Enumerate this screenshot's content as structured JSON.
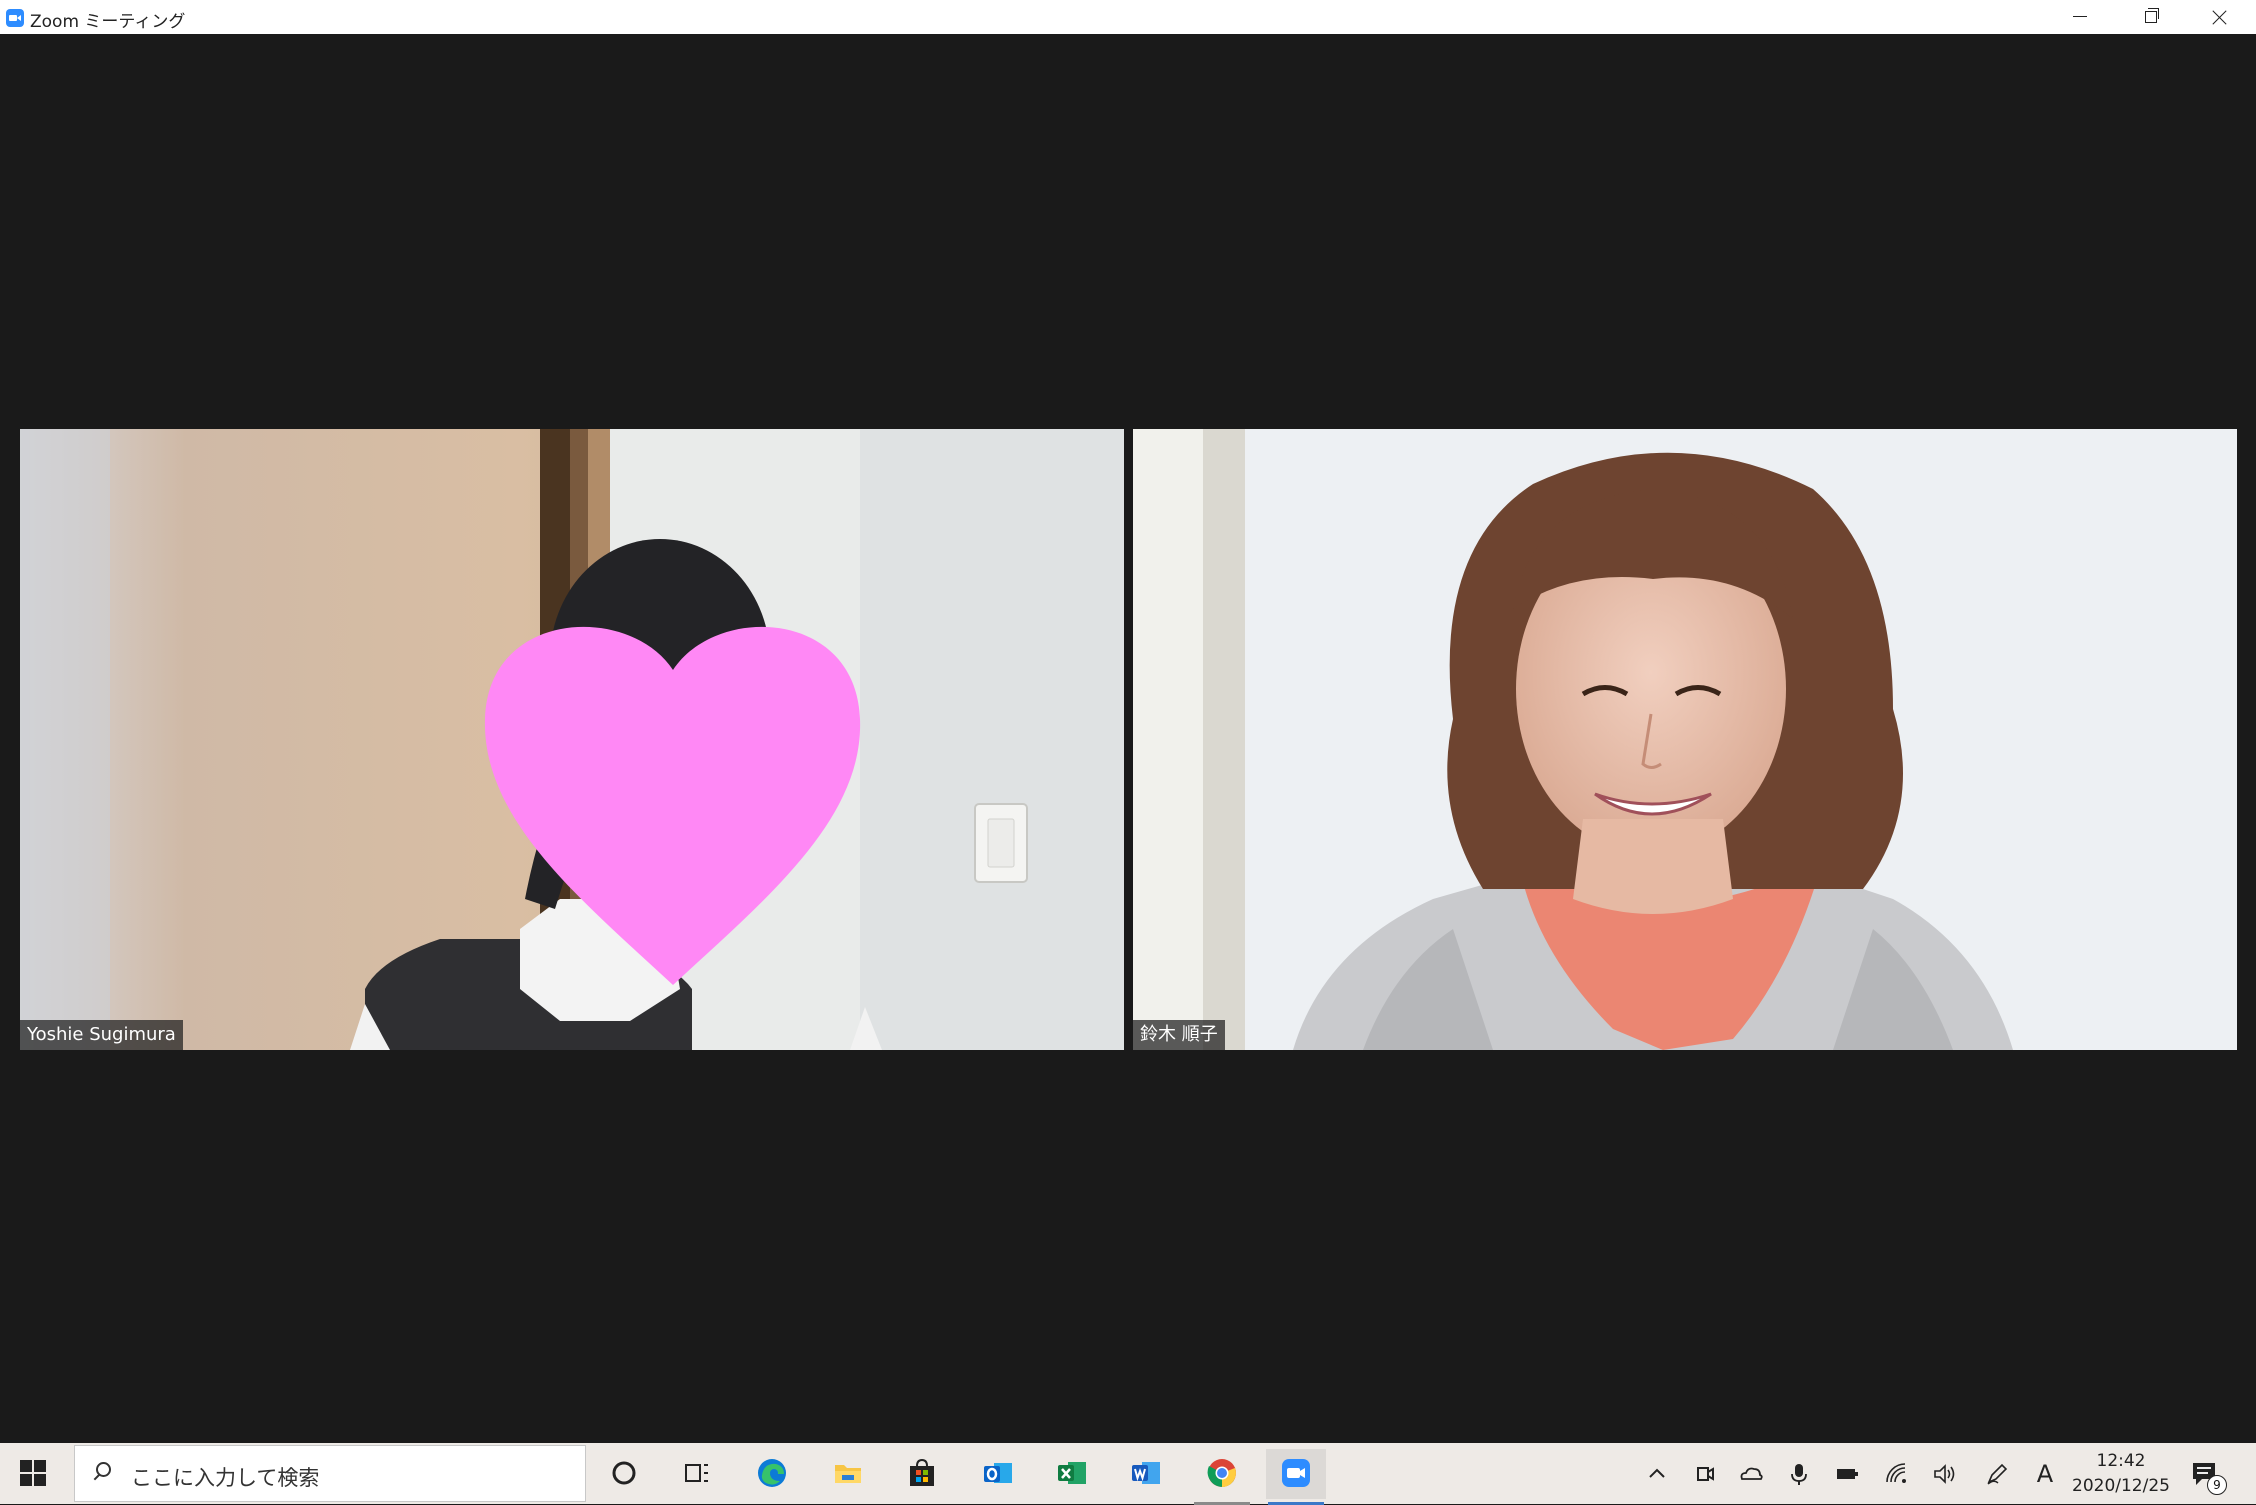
{
  "window": {
    "title": "Zoom ミーティング",
    "controls": [
      "minimize",
      "restore",
      "close"
    ]
  },
  "participants": [
    {
      "name": "Yoshie Sugimura"
    },
    {
      "name": "鈴木 順子"
    }
  ],
  "taskbar": {
    "search_placeholder": "ここに入力して検索",
    "pinned": [
      {
        "icon": "cortana-icon"
      },
      {
        "icon": "task-view-icon"
      },
      {
        "icon": "edge-icon"
      },
      {
        "icon": "file-explorer-icon"
      },
      {
        "icon": "store-icon"
      },
      {
        "icon": "outlook-icon"
      },
      {
        "icon": "excel-icon"
      },
      {
        "icon": "word-icon"
      },
      {
        "icon": "chrome-icon"
      },
      {
        "icon": "zoom-icon"
      }
    ],
    "tray": {
      "ime_indicator": "A",
      "time": "12:42",
      "date": "2020/12/25",
      "notification_count": "9"
    }
  }
}
